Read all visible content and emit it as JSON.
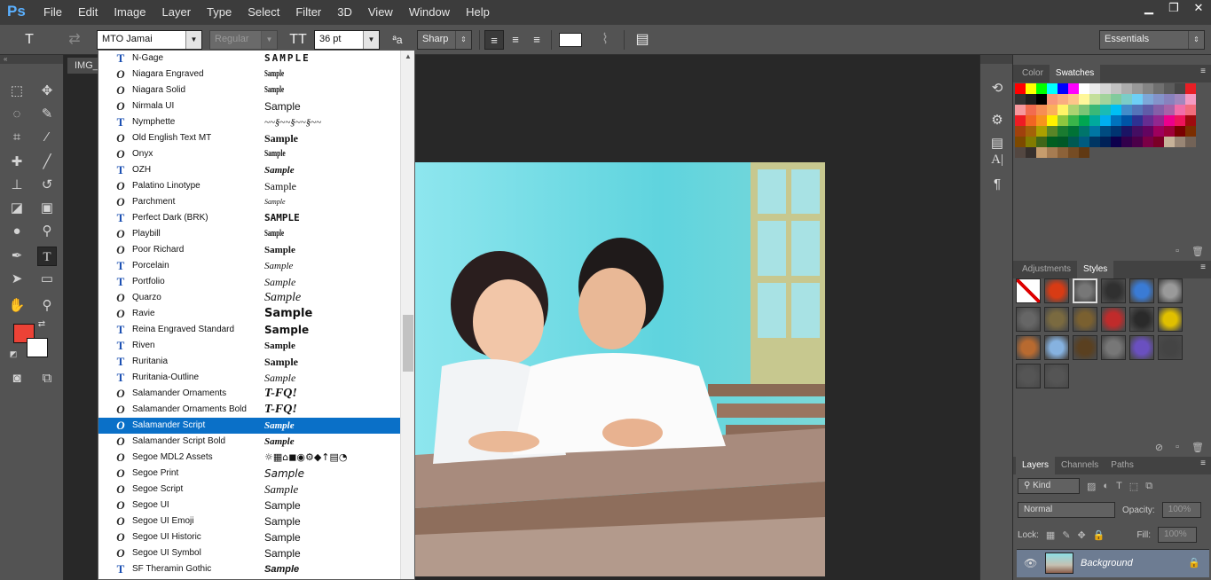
{
  "app": {
    "logo": "Ps",
    "menu": [
      "File",
      "Edit",
      "Image",
      "Layer",
      "Type",
      "Select",
      "Filter",
      "3D",
      "View",
      "Window",
      "Help"
    ],
    "window_controls": [
      "▁",
      "❐",
      "✕"
    ]
  },
  "options": {
    "type_tool_glyph": "T",
    "font_family": "MTO Jamai",
    "font_style": "Regular",
    "font_size": "36 pt",
    "antialias_glyph": "ªa",
    "antialias": "Sharp",
    "workspace": "Essentials"
  },
  "document": {
    "tab_label": "IMG_"
  },
  "font_list": {
    "selected_index": 23,
    "items": [
      {
        "name": "N-Gage",
        "type": "truetype",
        "sample": "SAMPLE"
      },
      {
        "name": "Niagara Engraved",
        "type": "opentype",
        "sample": "Sample"
      },
      {
        "name": "Niagara Solid",
        "type": "opentype",
        "sample": "Sample"
      },
      {
        "name": "Nirmala UI",
        "type": "opentype",
        "sample": "Sample"
      },
      {
        "name": "Nymphette",
        "type": "truetype",
        "sample": "~~§~~§~~§~~"
      },
      {
        "name": "Old English Text MT",
        "type": "opentype",
        "sample": "Sample"
      },
      {
        "name": "Onyx",
        "type": "opentype",
        "sample": "Sample"
      },
      {
        "name": "OZH",
        "type": "truetype",
        "sample": "Sample"
      },
      {
        "name": "Palatino Linotype",
        "type": "opentype",
        "sample": "Sample"
      },
      {
        "name": "Parchment",
        "type": "opentype",
        "sample": "Sample"
      },
      {
        "name": "Perfect Dark (BRK)",
        "type": "truetype",
        "sample": "SAMPLE"
      },
      {
        "name": "Playbill",
        "type": "opentype",
        "sample": "Sample"
      },
      {
        "name": "Poor Richard",
        "type": "opentype",
        "sample": "Sample"
      },
      {
        "name": "Porcelain",
        "type": "truetype",
        "sample": "Sample"
      },
      {
        "name": "Portfolio",
        "type": "truetype",
        "sample": "Sample"
      },
      {
        "name": "Quarzo",
        "type": "opentype",
        "sample": "Sample"
      },
      {
        "name": "Ravie",
        "type": "opentype",
        "sample": "Sample"
      },
      {
        "name": "Reina Engraved Standard",
        "type": "truetype",
        "sample": "Sample"
      },
      {
        "name": "Riven",
        "type": "truetype",
        "sample": "Sample"
      },
      {
        "name": "Ruritania",
        "type": "truetype",
        "sample": "Sample"
      },
      {
        "name": "Ruritania-Outline",
        "type": "truetype",
        "sample": "Sample"
      },
      {
        "name": "Salamander Ornaments",
        "type": "opentype",
        "sample": "T-FQ!"
      },
      {
        "name": "Salamander Ornaments Bold",
        "type": "opentype",
        "sample": "T-FQ!"
      },
      {
        "name": "Salamander Script",
        "type": "opentype",
        "sample": "Sample"
      },
      {
        "name": "Salamander Script Bold",
        "type": "opentype",
        "sample": "Sample"
      },
      {
        "name": "Segoe MDL2 Assets",
        "type": "opentype",
        "sample": "☼▦⌂◼◉⚙◆↑▤◔"
      },
      {
        "name": "Segoe Print",
        "type": "opentype",
        "sample": "Sample"
      },
      {
        "name": "Segoe Script",
        "type": "opentype",
        "sample": "Sample"
      },
      {
        "name": "Segoe UI",
        "type": "opentype",
        "sample": "Sample"
      },
      {
        "name": "Segoe UI Emoji",
        "type": "opentype",
        "sample": "Sample"
      },
      {
        "name": "Segoe UI Historic",
        "type": "opentype",
        "sample": "Sample"
      },
      {
        "name": "Segoe UI Symbol",
        "type": "opentype",
        "sample": "Sample"
      },
      {
        "name": "SF Theramin Gothic",
        "type": "truetype",
        "sample": "Sample"
      }
    ]
  },
  "tools": [
    "rect-marquee",
    "move",
    "lasso",
    "quick-select",
    "crop",
    "eyedropper",
    "healing",
    "brush",
    "clone-stamp",
    "history-brush",
    "eraser",
    "gradient",
    "blur",
    "dodge",
    "pen",
    "type",
    "path-select",
    "rectangle",
    "hand",
    "zoom"
  ],
  "right_panel": {
    "top_tabs": [
      "Color",
      "Swatches"
    ],
    "active_top": "Swatches",
    "mid_tabs": [
      "Adjustments",
      "Styles"
    ],
    "active_mid": "Styles",
    "bottom_tabs": [
      "Layers",
      "Channels",
      "Paths"
    ],
    "active_bottom": "Layers",
    "kind_label": "Kind",
    "blend_mode": "Normal",
    "opacity_label": "Opacity:",
    "opacity_value": "100%",
    "lock_label": "Lock:",
    "fill_label": "Fill:",
    "fill_value": "100%",
    "layer_name": "Background"
  },
  "swatch_colors": [
    "#ff0000",
    "#ffff00",
    "#00ff00",
    "#00ffff",
    "#0000ff",
    "#ff00ff",
    "#ffffff",
    "#ebebeb",
    "#d6d6d6",
    "#c2c2c2",
    "#adadad",
    "#999999",
    "#858585",
    "#707070",
    "#5c5c5c",
    "#474747",
    "#e81e25",
    "#333333",
    "#1f1f1f",
    "#000000",
    "#f7977a",
    "#f9ad81",
    "#fdc68a",
    "#fff79a",
    "#c4df9b",
    "#a3d39c",
    "#82ca9d",
    "#7bcdc8",
    "#6ecff6",
    "#7ea7d8",
    "#8493ca",
    "#8882be",
    "#a187be",
    "#f49ac2",
    "#f6989d",
    "#f26c4f",
    "#f68e55",
    "#fbaf5c",
    "#fff467",
    "#acd372",
    "#7cc576",
    "#3bb878",
    "#1abbb4",
    "#00bff3",
    "#438cca",
    "#5574b9",
    "#605ca8",
    "#855fa8",
    "#a763a8",
    "#f06ea9",
    "#f26d7d",
    "#ed1c24",
    "#f26522",
    "#f7941d",
    "#fff200",
    "#8dc73f",
    "#39b54a",
    "#00a651",
    "#00a99d",
    "#00aeef",
    "#0072bc",
    "#0054a6",
    "#2e3192",
    "#662d91",
    "#92278f",
    "#ec008c",
    "#ed145b",
    "#9e0b0f",
    "#a0410d",
    "#a36209",
    "#aba000",
    "#598527",
    "#1a7b30",
    "#007236",
    "#00746b",
    "#0076a3",
    "#004b80",
    "#003471",
    "#1b1464",
    "#440e62",
    "#630460",
    "#9e005d",
    "#9e0039",
    "#790000",
    "#7b2e00",
    "#7d4900",
    "#827b00",
    "#406618",
    "#005e20",
    "#005826",
    "#005952",
    "#005b7f",
    "#003663",
    "#002157",
    "#0d004c",
    "#32004b",
    "#4b0049",
    "#7b0046",
    "#7a0026",
    "#c7b299",
    "#998675",
    "#736357",
    "#534741",
    "#37302d",
    "#c69c6d",
    "#a67c52",
    "#8c6239",
    "#754c24",
    "#603913"
  ],
  "style_tiles": [
    "#ffffff",
    "#d83b14",
    "#777777",
    "#303030",
    "#3a7bd5",
    "#9a9a9a",
    "#666666",
    "#7a6a40",
    "#7a6030",
    "#c02b2b",
    "#2a2a2a",
    "#e0c000",
    "#b86a30",
    "#86b2e0",
    "#5a4020",
    "#777777",
    "#6a50c0",
    "#444444",
    "#555555",
    "#555555"
  ]
}
